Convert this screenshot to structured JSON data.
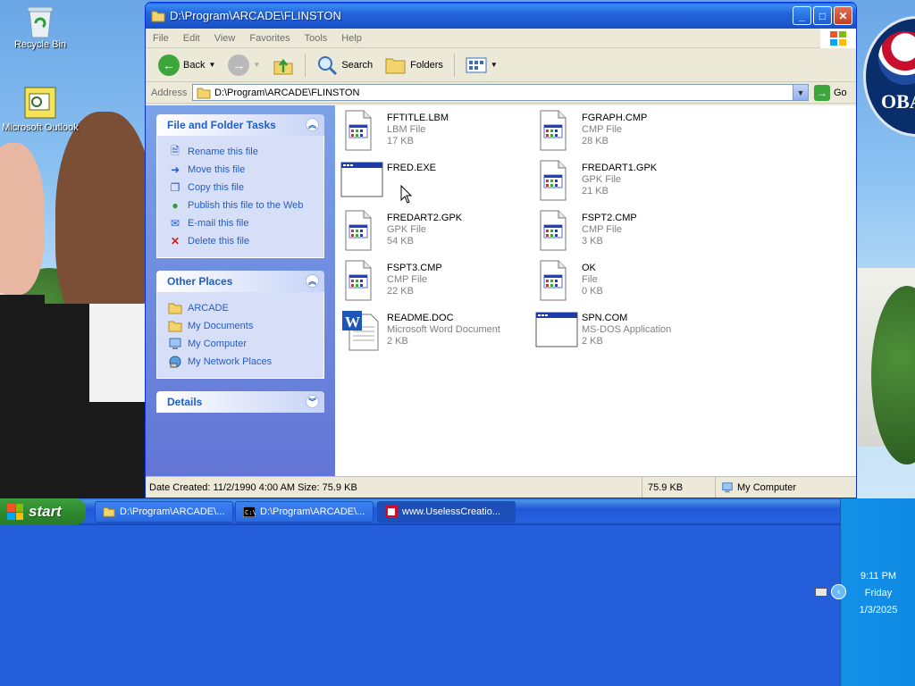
{
  "desktop": {
    "icons": [
      {
        "label": "Recycle Bin"
      },
      {
        "label": "Microsoft Outlook"
      }
    ],
    "wallpaper_logo": {
      "text": "OBA"
    }
  },
  "window": {
    "title": "D:\\Program\\ARCADE\\FLINSTON",
    "menu": [
      "File",
      "Edit",
      "View",
      "Favorites",
      "Tools",
      "Help"
    ],
    "toolbar": {
      "back": "Back",
      "search": "Search",
      "folders": "Folders"
    },
    "address": {
      "label": "Address",
      "value": "D:\\Program\\ARCADE\\FLINSTON",
      "go": "Go"
    },
    "tasks_panel": {
      "title": "File and Folder Tasks",
      "items": [
        {
          "label": "Rename this file",
          "icon": "rename-icon"
        },
        {
          "label": "Move this file",
          "icon": "move-icon"
        },
        {
          "label": "Copy this file",
          "icon": "copy-icon"
        },
        {
          "label": "Publish this file to the Web",
          "icon": "globe-icon"
        },
        {
          "label": "E-mail this file",
          "icon": "email-icon"
        },
        {
          "label": "Delete this file",
          "icon": "delete-icon"
        }
      ]
    },
    "places_panel": {
      "title": "Other Places",
      "items": [
        {
          "label": "ARCADE",
          "icon": "folder-icon"
        },
        {
          "label": "My Documents",
          "icon": "folder-icon"
        },
        {
          "label": "My Computer",
          "icon": "computer-icon"
        },
        {
          "label": "My Network Places",
          "icon": "network-icon"
        }
      ]
    },
    "details_panel": {
      "title": "Details"
    },
    "files": [
      {
        "name": "FFTITLE.LBM",
        "type": "LBM File",
        "size": "17 KB",
        "kind": "generic"
      },
      {
        "name": "FGRAPH.CMP",
        "type": "CMP File",
        "size": "28 KB",
        "kind": "generic"
      },
      {
        "name": "FRED.EXE",
        "type": "",
        "size": "",
        "kind": "exe"
      },
      {
        "name": "FREDART1.GPK",
        "type": "GPK File",
        "size": "21 KB",
        "kind": "generic"
      },
      {
        "name": "FREDART2.GPK",
        "type": "GPK File",
        "size": "54 KB",
        "kind": "generic"
      },
      {
        "name": "FSPT2.CMP",
        "type": "CMP File",
        "size": "3 KB",
        "kind": "generic"
      },
      {
        "name": "FSPT3.CMP",
        "type": "CMP File",
        "size": "22 KB",
        "kind": "generic"
      },
      {
        "name": "OK",
        "type": "File",
        "size": "0 KB",
        "kind": "generic"
      },
      {
        "name": "README.DOC",
        "type": "Microsoft Word Document",
        "size": "2 KB",
        "kind": "word"
      },
      {
        "name": "SPN.COM",
        "type": "MS-DOS Application",
        "size": "2 KB",
        "kind": "exe"
      }
    ],
    "status": {
      "info": "Date Created: 11/2/1990 4:00 AM Size: 75.9 KB",
      "size": "75.9 KB",
      "location": "My Computer"
    }
  },
  "taskbar": {
    "start": "start",
    "buttons": [
      {
        "label": "D:\\Program\\ARCADE\\..."
      },
      {
        "label": "D:\\Program\\ARCADE\\..."
      },
      {
        "label": "www.UselessCreatio..."
      }
    ],
    "clock": {
      "time": "9:11 PM",
      "day": "Friday",
      "date": "1/3/2025"
    }
  },
  "colors": {
    "accent": "#215dc6",
    "titlebar": "#1f5bd1",
    "taskbar": "#245edb"
  }
}
